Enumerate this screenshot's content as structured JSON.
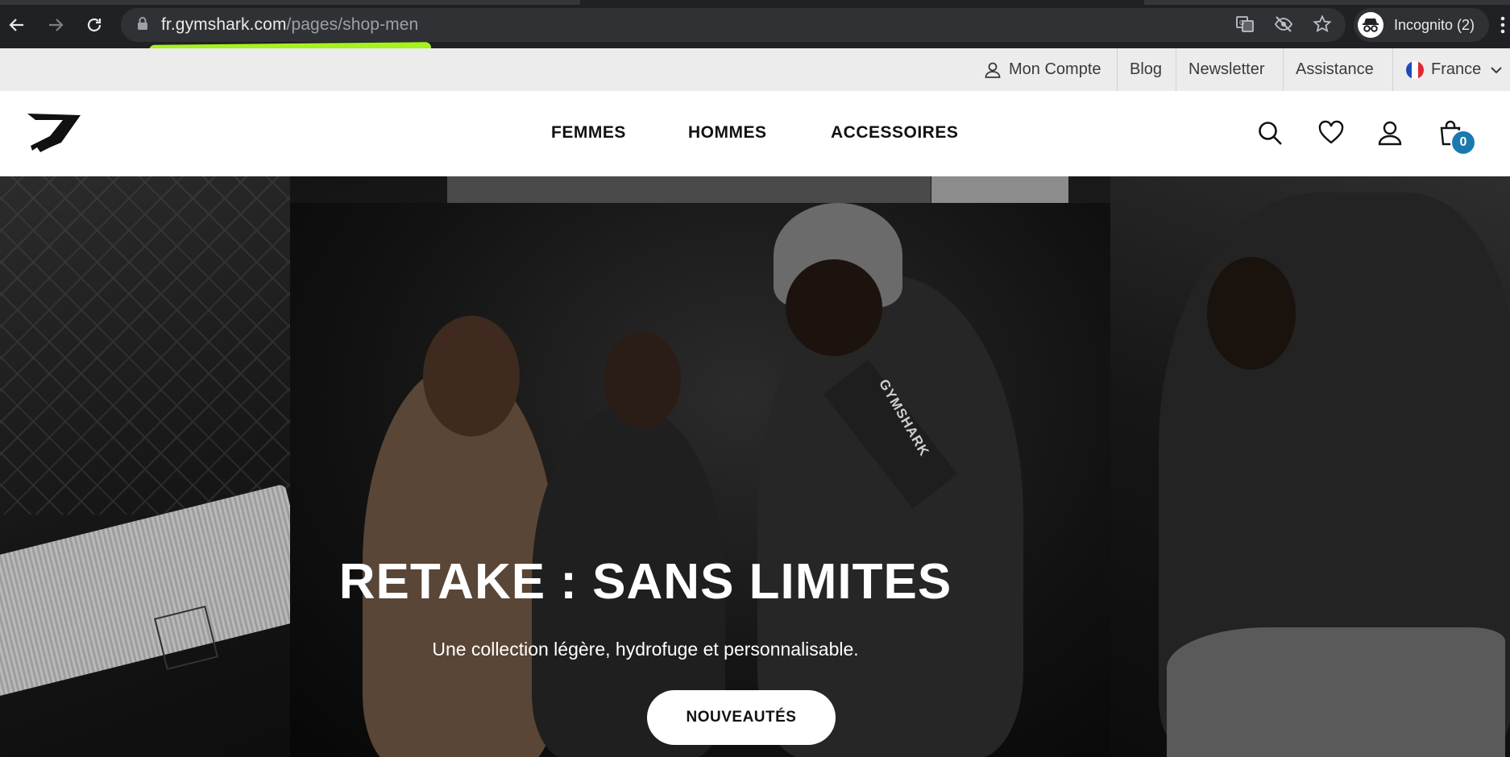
{
  "browser": {
    "url_host": "fr.gymshark.com",
    "url_path": "/pages/shop-men",
    "incognito_label": "Incognito (2)",
    "icons": [
      "back-icon",
      "forward-icon",
      "reload-icon",
      "lock-icon",
      "translate-icon",
      "eye-off-icon",
      "star-icon",
      "incognito-icon",
      "menu-kebab-icon"
    ]
  },
  "utility_bar": {
    "account": "Mon Compte",
    "blog": "Blog",
    "newsletter": "Newsletter",
    "support": "Assistance",
    "country": "France"
  },
  "nav": {
    "links": [
      "FEMMES",
      "HOMMES",
      "ACCESSOIRES"
    ],
    "cart_count": "0",
    "icons": [
      "search-icon",
      "wishlist-heart-icon",
      "account-icon",
      "cart-bag-icon"
    ]
  },
  "hero": {
    "title": "RETAKE : SANS LIMITES",
    "subtitle": "Une collection légère, hydrofuge et personnalisable.",
    "cta": "NOUVEAUTÉS",
    "strap_print": "GYMSHARK"
  },
  "colors": {
    "highlight": "#a6f21c",
    "cart_badge": "#1a7ab0",
    "chrome_bg": "#202124"
  }
}
